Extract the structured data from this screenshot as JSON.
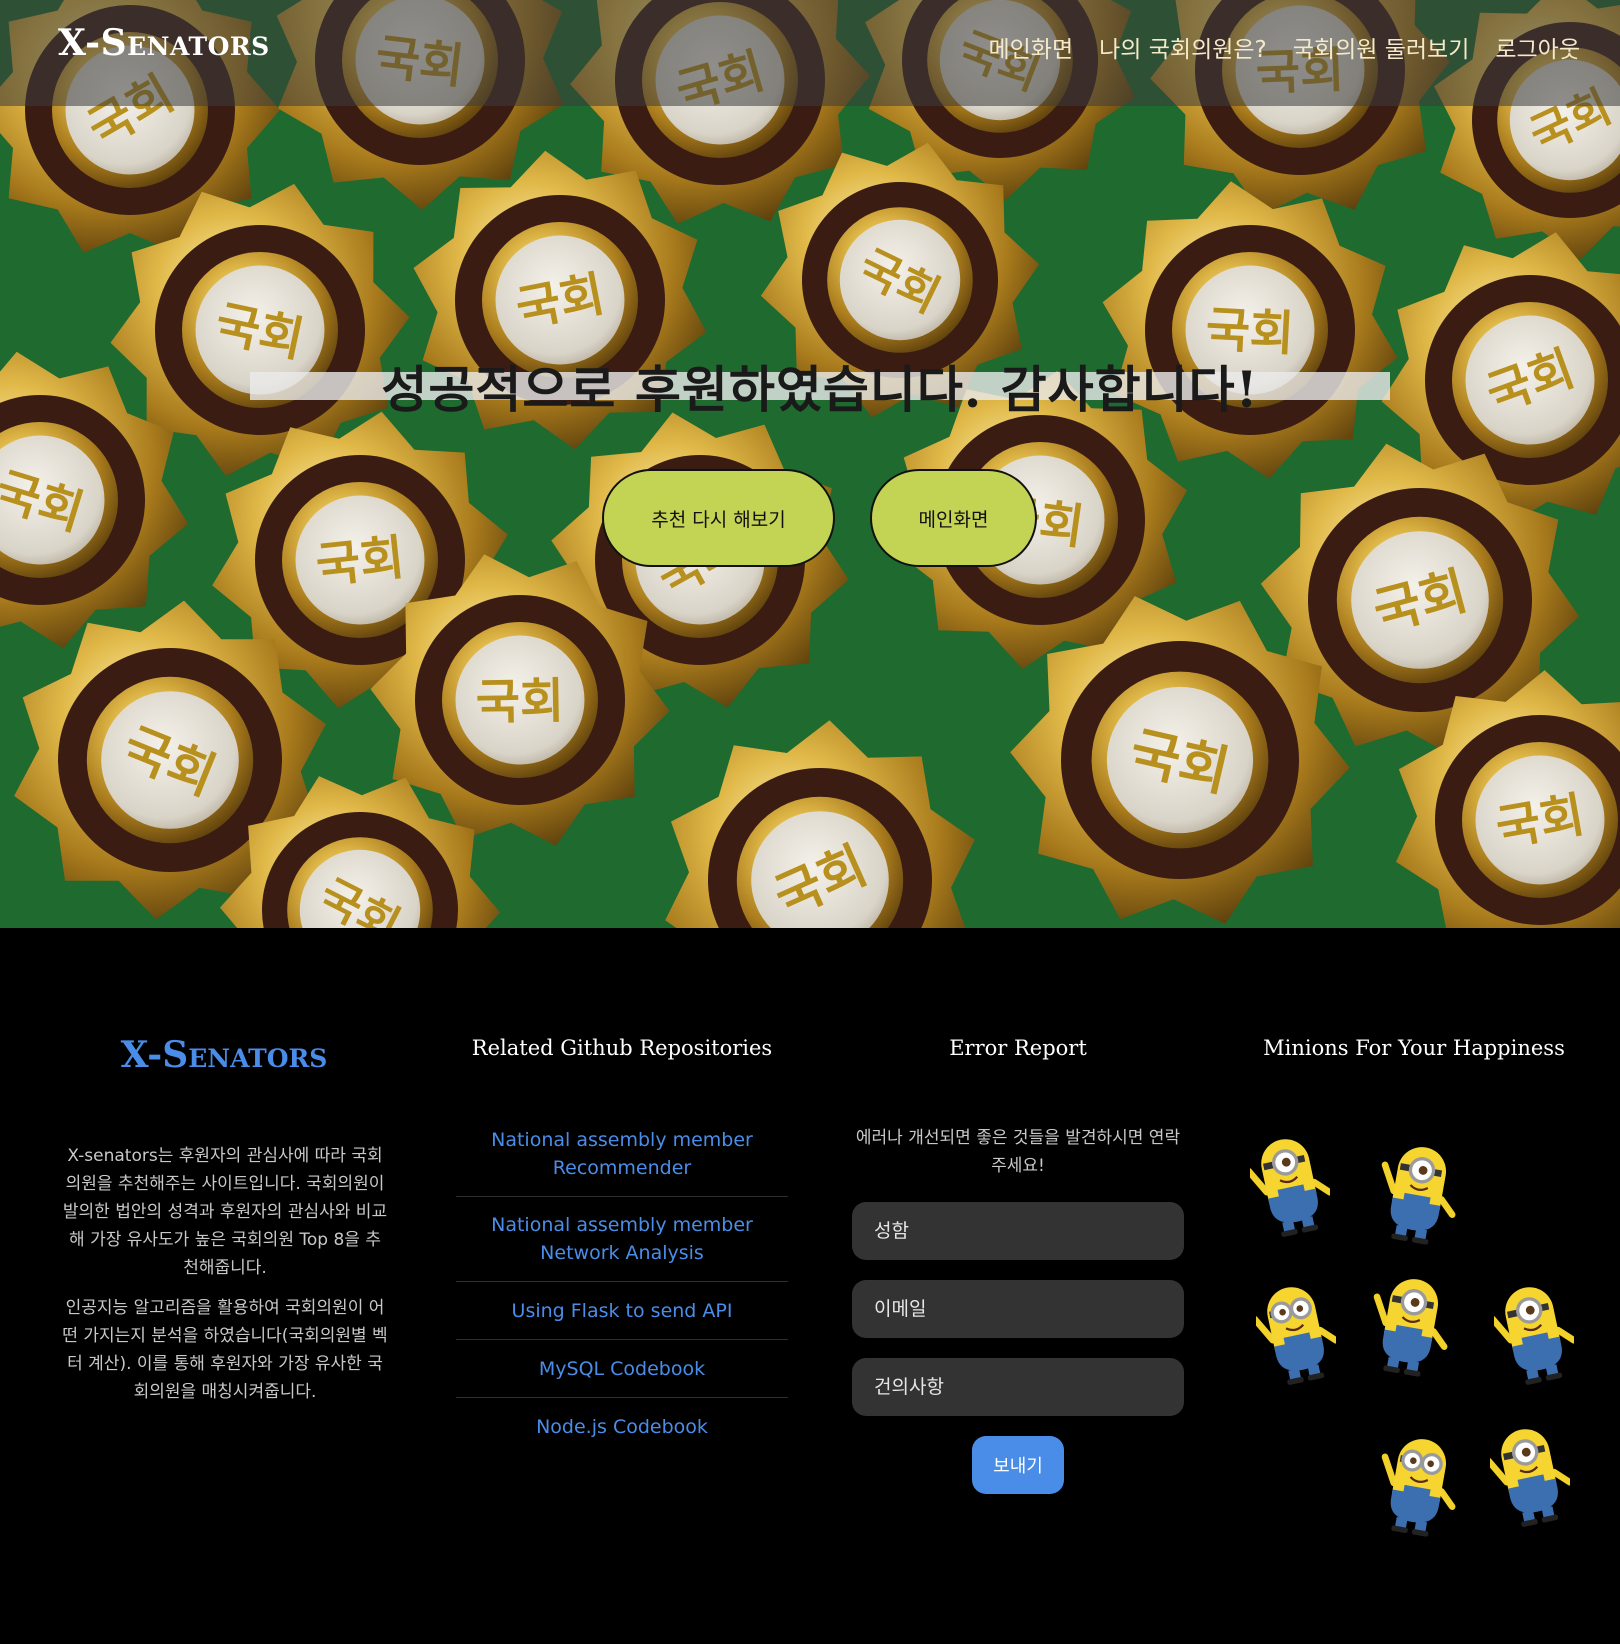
{
  "brand": "X-Senators",
  "nav": {
    "main": "메인화면",
    "my_member": "나의 국회의원은?",
    "browse": "국회의원 둘러보기",
    "logout": "로그아웃"
  },
  "hero": {
    "headline": "성공적으로 후원하였습니다. 감사합니다!",
    "retry_button": "추천 다시 해보기",
    "main_button": "메인화면",
    "badge_text": "국회",
    "colors": {
      "button_bg": "#c3d353",
      "felt": "#1f6b30",
      "gold": "#c9a43a"
    }
  },
  "footer": {
    "brand": "X-Senators",
    "about": [
      "X-senators는 후원자의 관심사에 따라 국회의원을 추천해주는 사이트입니다. 국회의원이 발의한 법안의 성격과 후원자의 관심사와 비교해 가장 유사도가 높은 국회의원 Top 8을 추천해줍니다.",
      "인공지능 알고리즘을 활용하여 국회의원이 어떤 가지는지 분석을 하였습니다(국회의원별 벡터 계산). 이를 통해 후원자와 가장 유사한 국회의원을 매칭시켜줍니다."
    ],
    "repos_title": "Related Github Repositories",
    "repos": [
      "National assembly member Recommender",
      "National assembly member Network Analysis",
      "Using Flask to send API",
      "MySQL Codebook",
      "Node.js Codebook"
    ],
    "error_title": "Error Report",
    "error_note": "에러나 개선되면 좋은 것들을 발견하시면 연락주세요!",
    "name_placeholder": "성함",
    "email_placeholder": "이메일",
    "suggest_placeholder": "건의사항",
    "send_button": "보내기",
    "minions_title": "Minions For Your Happiness",
    "colors": {
      "accent": "#4a8de8"
    }
  }
}
